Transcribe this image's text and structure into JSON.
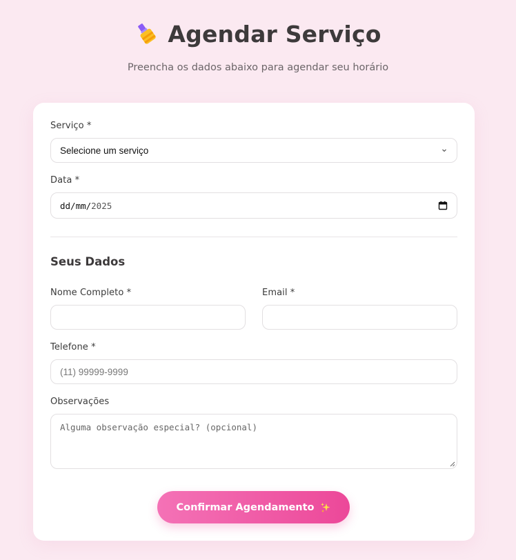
{
  "header": {
    "title": "Agendar Serviço",
    "subtitle": "Preencha os dados abaixo para agendar seu horário",
    "icon": "nail-polish-icon"
  },
  "form": {
    "service": {
      "label": "Serviço *",
      "selected": "Selecione um serviço"
    },
    "date": {
      "label": "Data *",
      "format": "dd/mm/",
      "year": "2025"
    },
    "section_title": "Seus Dados",
    "name": {
      "label": "Nome Completo *",
      "value": ""
    },
    "email": {
      "label": "Email *",
      "value": ""
    },
    "phone": {
      "label": "Telefone *",
      "placeholder": "(11) 99999-9999"
    },
    "notes": {
      "label": "Observações",
      "placeholder": "Alguma observação especial? (opcional)"
    },
    "submit_label": "Confirmar Agendamento"
  },
  "colors": {
    "background": "#fbe9f1",
    "accent_start": "#f472b6",
    "accent_end": "#ec4899"
  }
}
